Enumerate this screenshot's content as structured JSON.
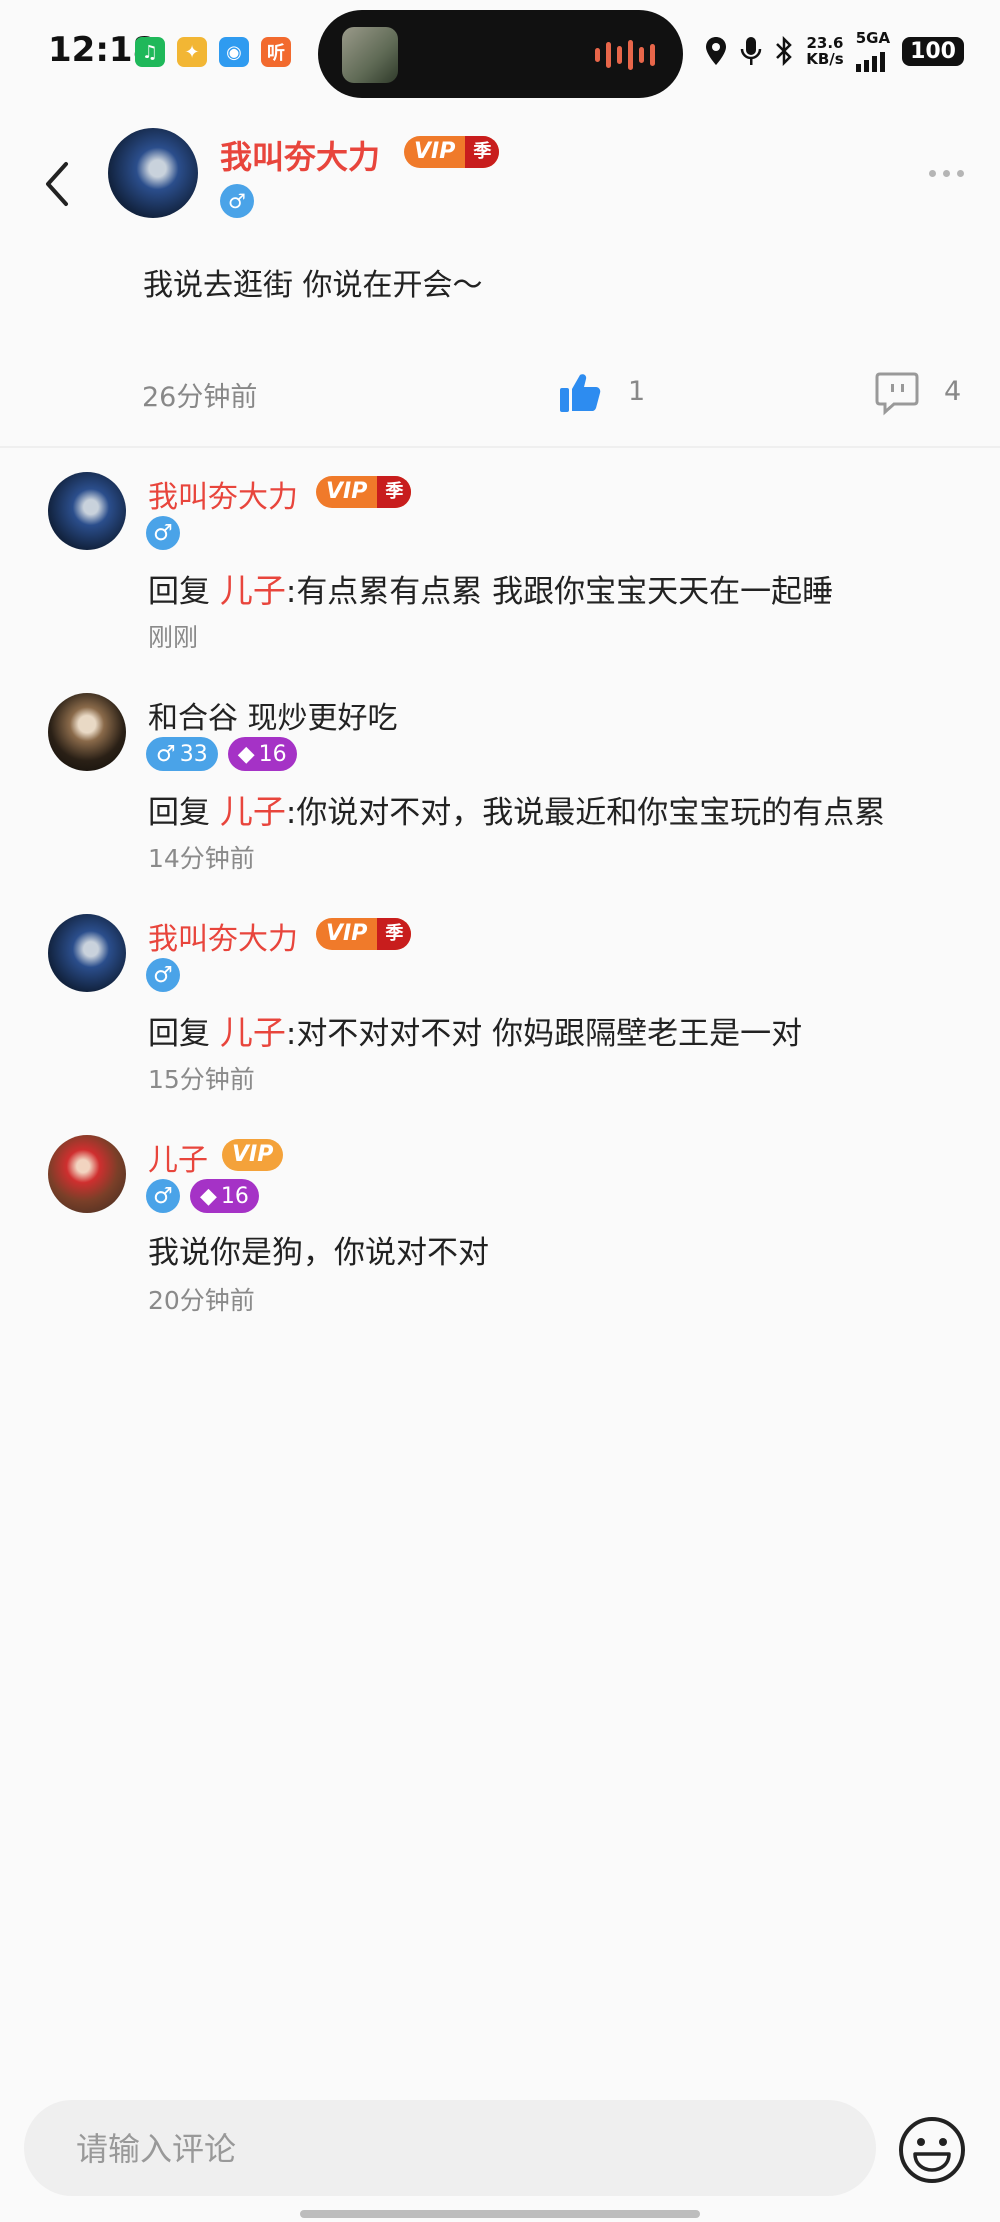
{
  "status_bar": {
    "time": "12:18",
    "app_icons": [
      {
        "name": "green-app-icon",
        "glyph": "♫",
        "color": "#1fb85a"
      },
      {
        "name": "yellow-app-icon",
        "glyph": "✦",
        "color": "#f2b634"
      },
      {
        "name": "blue-app-icon",
        "glyph": "◉",
        "color": "#2f9bf0"
      },
      {
        "name": "orange-app-icon",
        "glyph": "听",
        "color": "#f26a2e"
      }
    ],
    "network_speed": "23.6",
    "network_unit": "KB/s",
    "network_type": "5GA",
    "battery": "100"
  },
  "header": {
    "username": "我叫夯大力",
    "vip_label": "VIP",
    "vip_season": "季",
    "gender_symbol": "♂"
  },
  "post": {
    "text": "我说去逛街 你说在开会～",
    "time": "26分钟前",
    "like_count": "1",
    "comment_count": "4"
  },
  "comments": [
    {
      "name": "我叫夯大力",
      "vip_label": "VIP",
      "vip_season": "季",
      "gender_symbol": "♂",
      "reply_prefix": "回复",
      "reply_to": "儿子",
      "separator": ":",
      "text": "有点累有点累 我跟你宝宝天天在一起睡",
      "time": "刚刚"
    },
    {
      "name": "和合谷 现炒更好吃",
      "gender_symbol": "♂",
      "level": "33",
      "fan_level": "16",
      "reply_prefix": "回复",
      "reply_to": "儿子",
      "separator": ":",
      "text": "你说对不对，我说最近和你宝宝玩的有点累",
      "time": "14分钟前"
    },
    {
      "name": "我叫夯大力",
      "vip_label": "VIP",
      "vip_season": "季",
      "gender_symbol": "♂",
      "reply_prefix": "回复",
      "reply_to": "儿子",
      "separator": ":",
      "text": "对不对对不对 你妈跟隔壁老王是一对",
      "time": "15分钟前"
    },
    {
      "name": "儿子",
      "vip_label": "VIP",
      "gender_symbol": "♂",
      "fan_level": "16",
      "text": "我说你是狗，你说对不对",
      "time": "20分钟前"
    }
  ],
  "input": {
    "placeholder": "请输入评论"
  },
  "colors": {
    "accent_red": "#e8453c",
    "vip_orange": "#f07a2a",
    "gender_blue": "#4aa3e8",
    "fan_purple": "#a532c6",
    "like_blue": "#2d8cf0"
  }
}
